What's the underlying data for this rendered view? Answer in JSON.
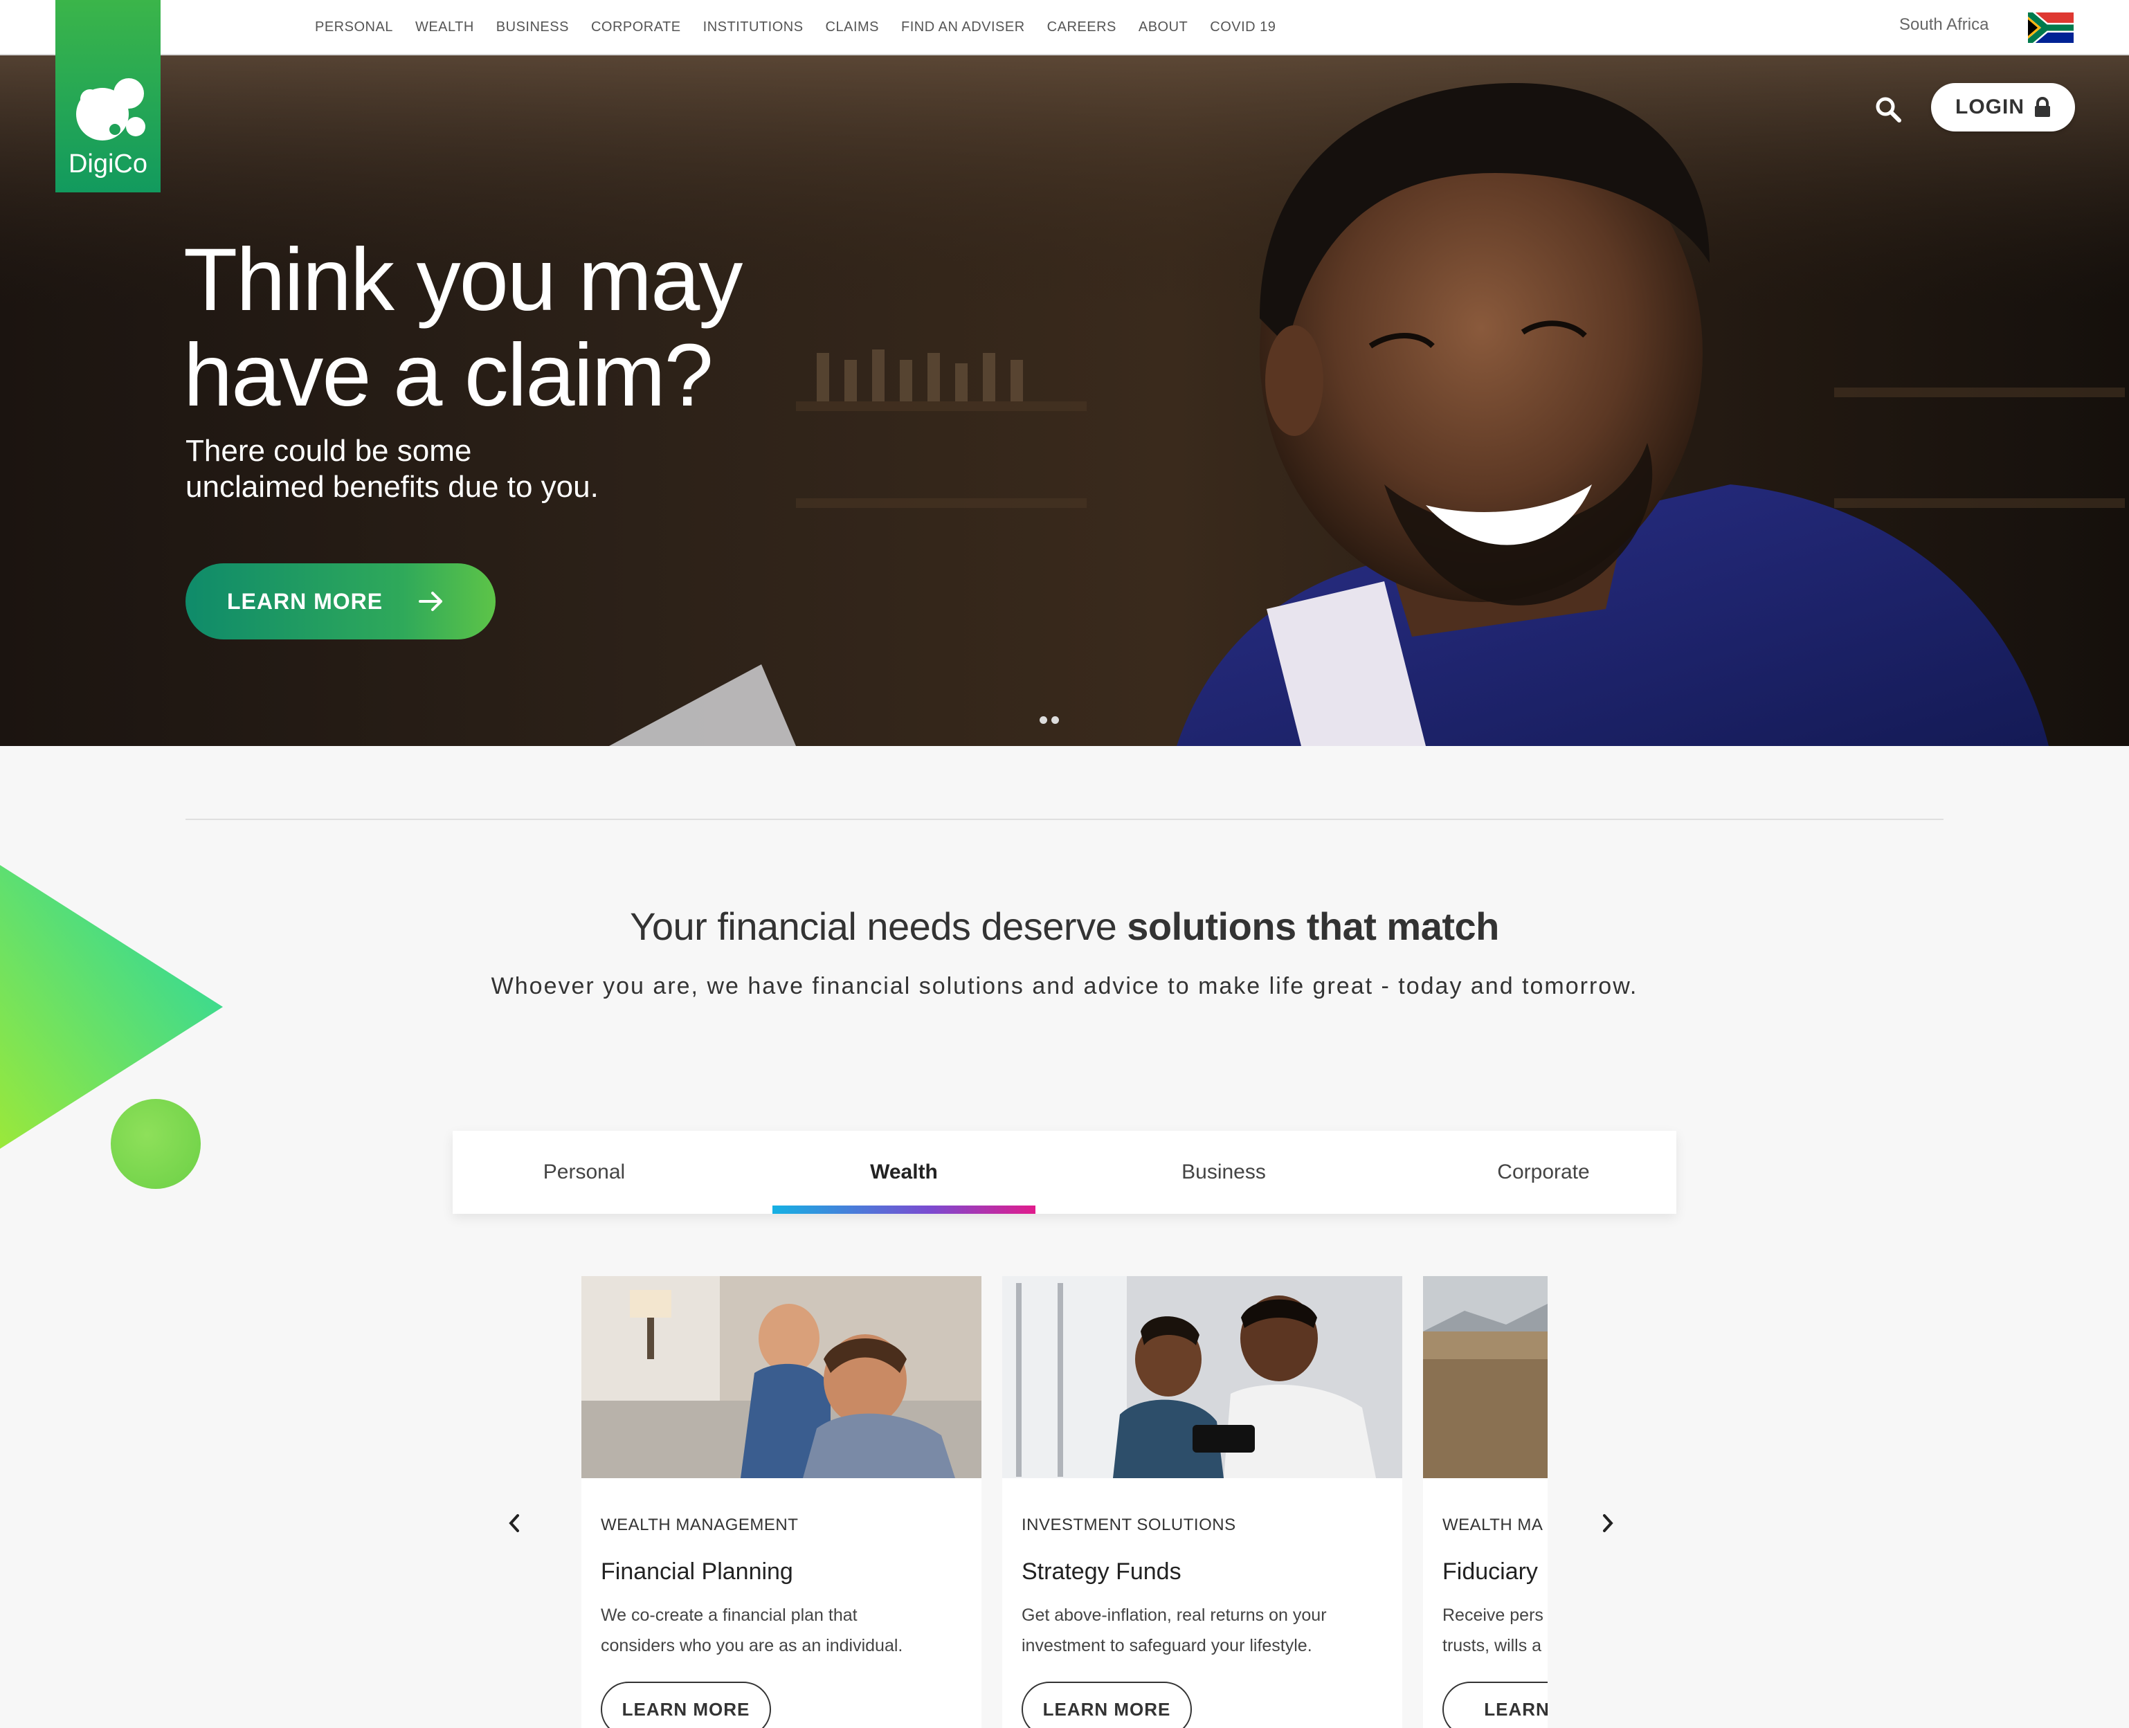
{
  "brand": {
    "name": "DigiCo",
    "green_top": "#3bb54a",
    "green_bottom": "#129a5e"
  },
  "nav": {
    "items": [
      "PERSONAL",
      "WEALTH",
      "BUSINESS",
      "CORPORATE",
      "INSTITUTIONS",
      "CLAIMS",
      "FIND AN ADVISER",
      "CAREERS",
      "ABOUT",
      "COVID 19"
    ],
    "region": "South Africa"
  },
  "hero": {
    "title_line1": "Think you may",
    "title_line2": "have a claim?",
    "subtitle_line1": "There could be some",
    "subtitle_line2": "unclaimed benefits due to you.",
    "cta_label": "LEARN MORE",
    "login_label": "LOGIN"
  },
  "section": {
    "heading_light": "Your financial needs deserve ",
    "heading_bold": "solutions that match",
    "subheading": "Whoever you are, we have financial solutions and advice to make life great - today and tomorrow."
  },
  "tabs": {
    "items": [
      "Personal",
      "Wealth",
      "Business",
      "Corporate"
    ],
    "active": "Wealth",
    "underline_gradient": [
      "#15b1e3",
      "#7b4bd0",
      "#e11c8c"
    ]
  },
  "cards": [
    {
      "category": "WEALTH MANAGEMENT",
      "title": "Financial Planning",
      "desc_line1": "We co-create a financial plan that",
      "desc_line2": "considers who you are as an individual.",
      "button": "LEARN MORE"
    },
    {
      "category": "INVESTMENT SOLUTIONS",
      "title": "Strategy Funds",
      "desc_line1": "Get above-inflation, real returns on your",
      "desc_line2": "investment to safeguard your lifestyle.",
      "button": "LEARN MORE"
    },
    {
      "category": "WEALTH MA",
      "title": "Fiduciary",
      "desc_line1": "Receive pers",
      "desc_line2": "trusts, wills a",
      "button": "LEARN M"
    }
  ]
}
